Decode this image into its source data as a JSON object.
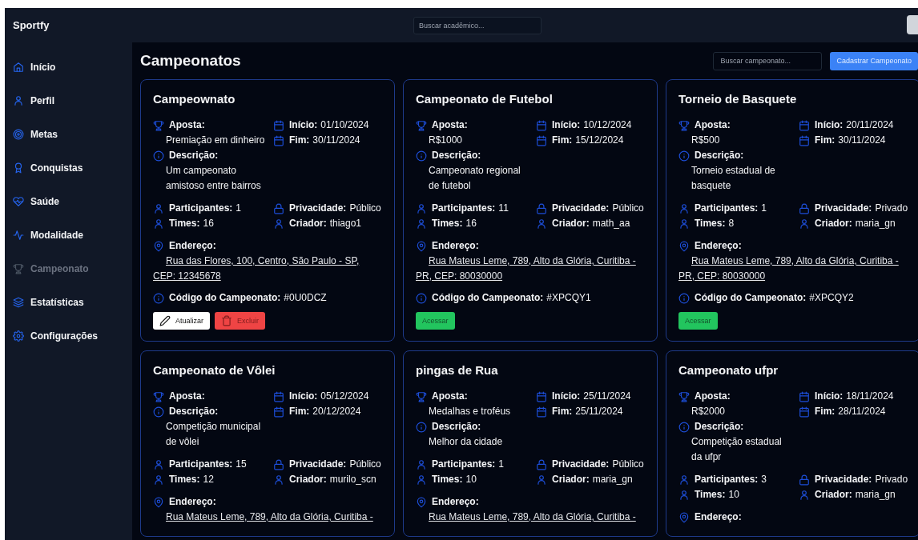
{
  "header": {
    "brand": "Sportfy",
    "search": {
      "placeholder": "Buscar acadêmico..."
    }
  },
  "sidebar": {
    "items": [
      {
        "label": "Início",
        "selected": false
      },
      {
        "label": "Perfil",
        "selected": false
      },
      {
        "label": "Metas",
        "selected": false
      },
      {
        "label": "Conquistas",
        "selected": false
      },
      {
        "label": "Saúde",
        "selected": false
      },
      {
        "label": "Modalidade",
        "selected": false
      },
      {
        "label": "Campeonato",
        "selected": true
      },
      {
        "label": "Estatísticas",
        "selected": false
      },
      {
        "label": "Configurações",
        "selected": false
      }
    ]
  },
  "page": {
    "title": "Campeonatos",
    "search": {
      "placeholder": "Buscar campeonato..."
    },
    "create_button": "Cadastrar Campeonato"
  },
  "cards": [
    {
      "title": "Campeownato",
      "bet": {
        "label": "Aposta:",
        "value": "Premiação em dinheiro"
      },
      "description": {
        "label": "Descrição:",
        "value": "Um campeonato amistoso entre bairros"
      },
      "start": {
        "label": "Início:",
        "value": "01/10/2024"
      },
      "end": {
        "label": "Fim:",
        "value": "30/11/2024"
      },
      "participants": {
        "label": "Participantes:",
        "value": "1"
      },
      "privacy": {
        "label": "Privacidade:",
        "value": "Público"
      },
      "teams": {
        "label": "Times:",
        "value": "16"
      },
      "creator": {
        "label": "Criador:",
        "value": "thiago1"
      },
      "address": {
        "label": "Endereço:",
        "value": "Rua das Flores, 100, Centro, São Paulo - SP, CEP: 12345678"
      },
      "code": {
        "label": "Código do Campeonato:",
        "value": "#0U0DCZ"
      },
      "actions": [
        {
          "kind": "edit",
          "label": "Atualizar"
        },
        {
          "kind": "delete",
          "label": "Excluir"
        }
      ]
    },
    {
      "title": "Campeonato de Futebol",
      "bet": {
        "label": "Aposta:",
        "value": "R$1000"
      },
      "description": {
        "label": "Descrição:",
        "value": "Campeonato regional de futebol"
      },
      "start": {
        "label": "Início:",
        "value": "10/12/2024"
      },
      "end": {
        "label": "Fim:",
        "value": "15/12/2024"
      },
      "participants": {
        "label": "Participantes:",
        "value": "11"
      },
      "privacy": {
        "label": "Privacidade:",
        "value": "Público"
      },
      "teams": {
        "label": "Times:",
        "value": "16"
      },
      "creator": {
        "label": "Criador:",
        "value": "math_aa"
      },
      "address": {
        "label": "Endereço:",
        "value": "Rua Mateus Leme, 789, Alto da Glória, Curitiba - PR, CEP: 80030000"
      },
      "code": {
        "label": "Código do Campeonato:",
        "value": "#XPCQY1"
      },
      "actions": [
        {
          "kind": "access",
          "label": "Acessar"
        }
      ]
    },
    {
      "title": "Torneio de Basquete",
      "bet": {
        "label": "Aposta:",
        "value": "R$500"
      },
      "description": {
        "label": "Descrição:",
        "value": "Torneio estadual de basquete"
      },
      "start": {
        "label": "Início:",
        "value": "20/11/2024"
      },
      "end": {
        "label": "Fim:",
        "value": "30/11/2024"
      },
      "participants": {
        "label": "Participantes:",
        "value": "1"
      },
      "privacy": {
        "label": "Privacidade:",
        "value": "Privado"
      },
      "teams": {
        "label": "Times:",
        "value": "8"
      },
      "creator": {
        "label": "Criador:",
        "value": "maria_gn"
      },
      "address": {
        "label": "Endereço:",
        "value": "Rua Mateus Leme, 789, Alto da Glória, Curitiba - PR, CEP: 80030000"
      },
      "code": {
        "label": "Código do Campeonato:",
        "value": "#XPCQY2"
      },
      "actions": [
        {
          "kind": "access",
          "label": "Acessar"
        }
      ]
    },
    {
      "title": "Campeonato de Vôlei",
      "bet": {
        "label": "Aposta:"
      },
      "description": {
        "label": "Descrição:",
        "value": "Competição municipal de vôlei"
      },
      "start": {
        "label": "Início:",
        "value": "05/12/2024"
      },
      "end": {
        "label": "Fim:",
        "value": "20/12/2024"
      },
      "participants": {
        "label": "Participantes:",
        "value": "15"
      },
      "privacy": {
        "label": "Privacidade:",
        "value": "Público"
      },
      "teams": {
        "label": "Times:",
        "value": "12"
      },
      "creator": {
        "label": "Criador:",
        "value": "murilo_scn"
      },
      "address": {
        "label": "Endereço:",
        "value": "Rua Mateus Leme, 789, Alto da Glória, Curitiba -"
      }
    },
    {
      "title": "pingas de Rua",
      "bet": {
        "label": "Aposta:",
        "value": "Medalhas e troféus"
      },
      "description": {
        "label": "Descrição:",
        "value": "Melhor da cidade"
      },
      "start": {
        "label": "Início:",
        "value": "25/11/2024"
      },
      "end": {
        "label": "Fim:",
        "value": "25/11/2024"
      },
      "participants": {
        "label": "Participantes:",
        "value": "1"
      },
      "privacy": {
        "label": "Privacidade:",
        "value": "Público"
      },
      "teams": {
        "label": "Times:",
        "value": "10"
      },
      "creator": {
        "label": "Criador:",
        "value": "maria_gn"
      },
      "address": {
        "label": "Endereço:",
        "value": "Rua Mateus Leme, 789, Alto da Glória, Curitiba -"
      }
    },
    {
      "title": "Campeonato ufpr",
      "bet": {
        "label": "Aposta:",
        "value": "R$2000"
      },
      "description": {
        "label": "Descrição:",
        "value": "Competição estadual da ufpr"
      },
      "start": {
        "label": "Início:",
        "value": "18/11/2024"
      },
      "end": {
        "label": "Fim:",
        "value": "28/11/2024"
      },
      "participants": {
        "label": "Participantes:",
        "value": "3"
      },
      "privacy": {
        "label": "Privacidade:",
        "value": "Privado"
      },
      "teams": {
        "label": "Times:",
        "value": "10"
      },
      "creator": {
        "label": "Criador:",
        "value": "maria_gn"
      },
      "address": {
        "label": "Endereço:"
      }
    }
  ]
}
